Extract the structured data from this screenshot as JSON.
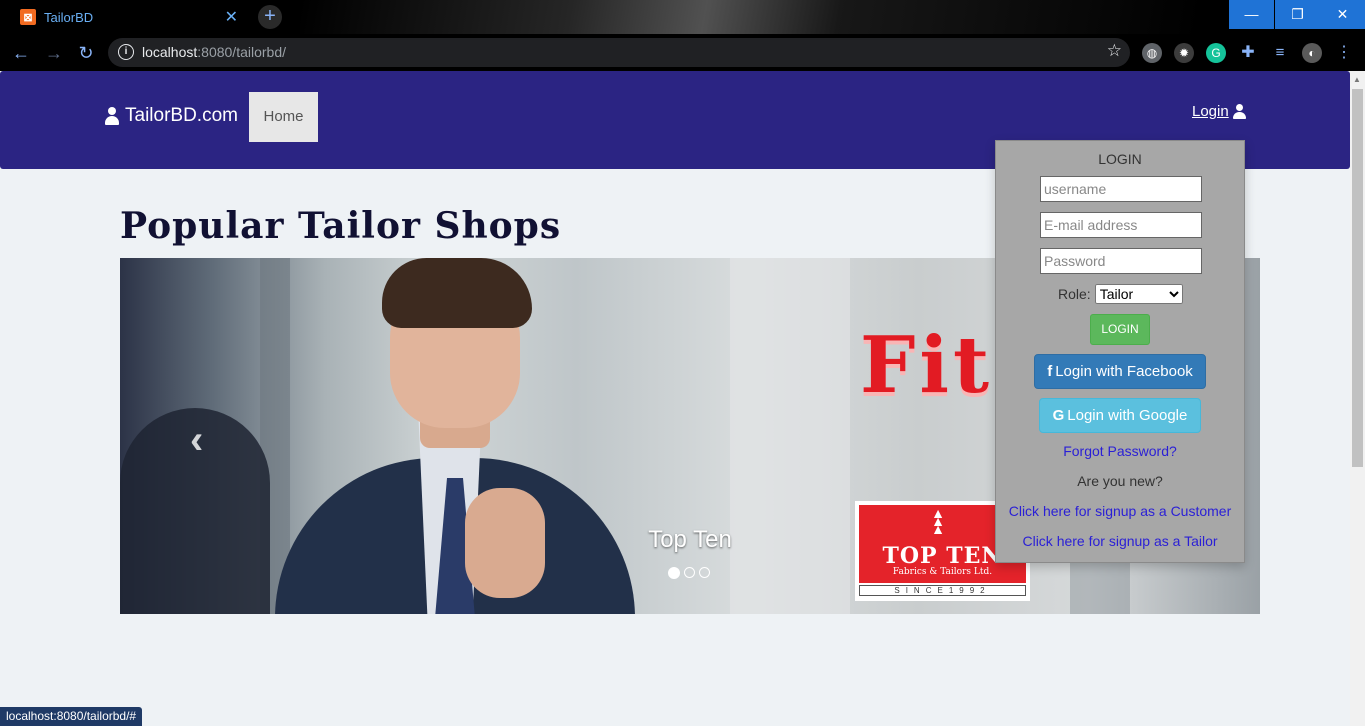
{
  "browser": {
    "tab_title": "TailorBD",
    "tab_close": "✕",
    "new_tab": "+",
    "url_host": "localhost",
    "url_rest": ":8080/tailorbd/",
    "window_min": "—",
    "window_max": "❐",
    "window_close": "✕",
    "status_url": "localhost:8080/tailorbd/#"
  },
  "navbar": {
    "brand": "TailorBD.com",
    "home": "Home",
    "login": "Login"
  },
  "main": {
    "heading": "Popular Tailor Shops"
  },
  "carousel": {
    "caption": "Top Ten",
    "prev": "‹",
    "slide_text": "Fit",
    "logo_name": "TOP TEN",
    "logo_sub": "Fabrics & Tailors Ltd.",
    "logo_since": "SINCE1992",
    "active_slide": 1,
    "slide_count": 3
  },
  "login_panel": {
    "title": "LOGIN",
    "username_placeholder": "username",
    "email_placeholder": "E-mail address",
    "password_placeholder": "Password",
    "role_label": "Role:",
    "role_value": "Tailor",
    "login_button": "LOGIN",
    "facebook_button": "Login with Facebook",
    "google_button": "Login with Google",
    "forgot": "Forgot Password?",
    "new_prompt": "Are you new?",
    "signup_customer": "Click here for signup as a Customer",
    "signup_tailor": "Click here for signup as a Tailor"
  },
  "colors": {
    "navbar": "#2b2483",
    "link": "#2a1fd6",
    "login_green": "#5cb85c",
    "facebook_blue": "#337ab7",
    "google_cyan": "#5bc0de"
  }
}
